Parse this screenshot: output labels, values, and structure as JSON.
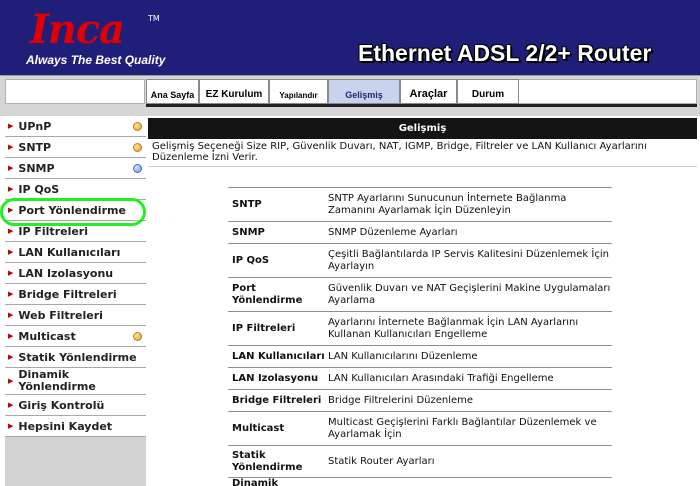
{
  "brand": {
    "logo": "Inca",
    "trademark": "TM",
    "tagline": "Always The Best Quality",
    "product_title": "Ethernet ADSL 2/2+ Router"
  },
  "tabs": [
    {
      "label": "Ana Sayfa",
      "active": false
    },
    {
      "label": "EZ Kurulum",
      "active": false
    },
    {
      "label": "Yapılandır",
      "active": false
    },
    {
      "label": "Gelişmiş",
      "active": true
    },
    {
      "label": "Araçlar",
      "active": false
    },
    {
      "label": "Durum",
      "active": false
    }
  ],
  "sidebar": {
    "items": [
      {
        "label": "UPnP",
        "dot": "orange"
      },
      {
        "label": "SNTP",
        "dot": "orange"
      },
      {
        "label": "SNMP",
        "dot": "blue"
      },
      {
        "label": "IP QoS",
        "dot": ""
      },
      {
        "label": "Port Yönlendirme",
        "dot": ""
      },
      {
        "label": "IP Filtreleri",
        "dot": ""
      },
      {
        "label": "LAN Kullanıcıları",
        "dot": ""
      },
      {
        "label": "LAN Izolasyonu",
        "dot": ""
      },
      {
        "label": "Bridge Filtreleri",
        "dot": ""
      },
      {
        "label": "Web Filtreleri",
        "dot": ""
      },
      {
        "label": "Multicast",
        "dot": "orange"
      },
      {
        "label": "Statik Yönlendirme",
        "dot": ""
      },
      {
        "label": "Dinamik Yönlendirme",
        "dot": ""
      },
      {
        "label": "Giriş Kontrolü",
        "dot": ""
      },
      {
        "label": "Hepsini Kaydet",
        "dot": ""
      }
    ]
  },
  "content": {
    "heading": "Gelişmiş",
    "description": "Gelişmiş Seçeneği Size RIP, Güvenlik Duvarı, NAT, IGMP, Bridge, Filtreler ve LAN Kullanıcı Ayarlarını Düzenleme İzni Verir.",
    "rows": [
      {
        "key": "SNTP",
        "value": "SNTP Ayarlarını Sunucunun İnternete Bağlanma Zamanını Ayarlamak İçin Düzenleyin"
      },
      {
        "key": "SNMP",
        "value": "SNMP Düzenleme Ayarları"
      },
      {
        "key": "IP QoS",
        "value": "Çeşitli Bağlantılarda IP Servis Kalitesini Düzenlemek İçin Ayarlayın"
      },
      {
        "key": "Port Yönlendirme",
        "value": "Güvenlik Duvarı  ve NAT Geçişlerini Makine Uygulamaları Ayarlama"
      },
      {
        "key": "IP Filtreleri",
        "value": "Ayarlarını İnternete Bağlanmak İçin LAN Ayarlarını Kullanan Kullanıcıları Engelleme"
      },
      {
        "key": "LAN Kullanıcıları",
        "value": "LAN Kullanıcılarını Düzenleme"
      },
      {
        "key": "LAN Izolasyonu",
        "value": "LAN Kullanıcıları Arasındaki Trafiği Engelleme"
      },
      {
        "key": "Bridge Filtreleri",
        "value": "Bridge Filtrelerini Düzenleme"
      },
      {
        "key": "Multicast",
        "value": "Multicast Geçişlerini Farklı Bağlantılar Düzenlemek ve Ayarlamak İçin"
      },
      {
        "key": "Statik Yönlendirme",
        "value": "Statik Router Ayarları"
      },
      {
        "key": "Dinamik",
        "value": ""
      }
    ]
  }
}
